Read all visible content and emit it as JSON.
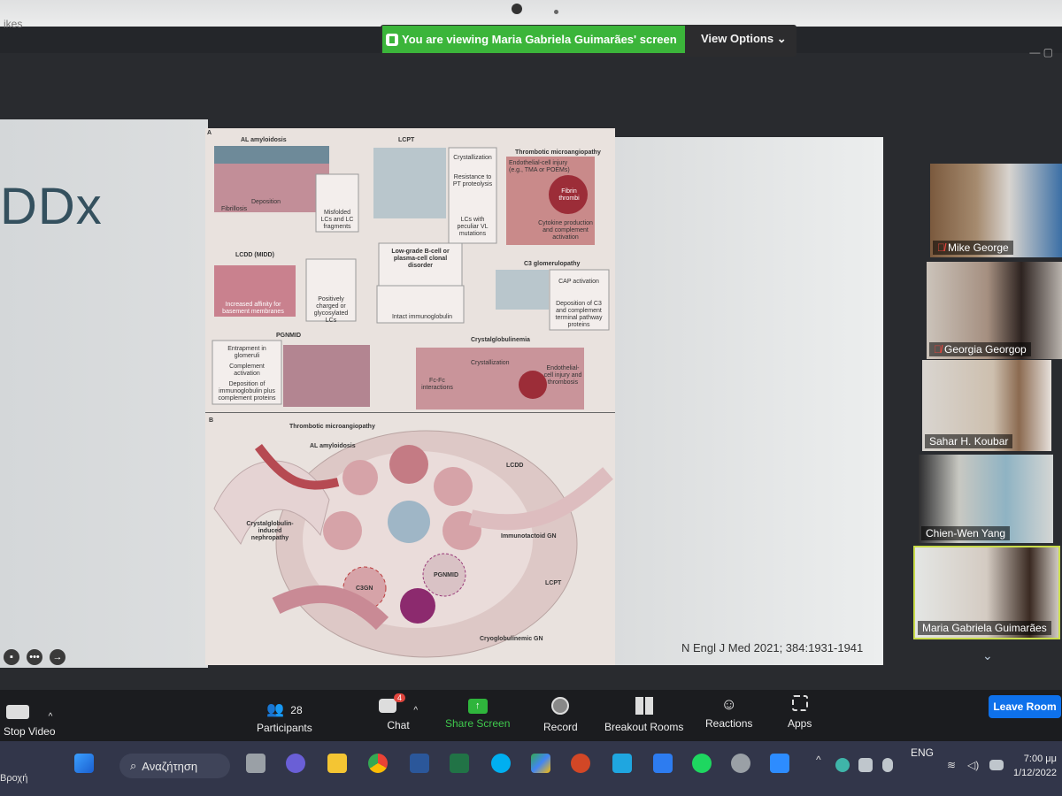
{
  "window": {
    "partial_title": "ikes",
    "controls": "— ▢"
  },
  "share_banner": {
    "viewing_text": "You are viewing Maria Gabriela Guimarães' screen",
    "view_options_label": "View Options"
  },
  "slide": {
    "title": "DDx",
    "citation": "N Engl J Med 2021; 384:1931-1941",
    "figure": {
      "panel_a_label": "A",
      "panel_b_label": "B",
      "a_labels": [
        "AL amyloidosis",
        "LCPT",
        "Thrombotic microangiopathy",
        "Crystallization",
        "Resistance to PT proteolysis",
        "Endothelial-cell injury (e.g., TMA or POEMs)",
        "Deposition",
        "Fibrillosis",
        "Misfolded LCs and LC fragments",
        "LCs with peculiar VL mutations",
        "Fibrin thrombi",
        "Cytokine production and complement activation",
        "Low-grade B-cell or plasma-cell clonal disorder",
        "LCDD (MIDD)",
        "C3 glomerulopathy",
        "Increased affinity for basement membranes",
        "Positively charged or glycosylated LCs",
        "Intact immunoglobulin",
        "CAP activation",
        "Deposition of C3 and complement terminal pathway proteins",
        "PGNMID",
        "Crystalglobulinemia",
        "Entrapment in glomeruli",
        "Complement activation",
        "Deposition of immunoglobulin plus complement proteins",
        "Crystallization",
        "Fc-Fc interactions",
        "Endothelial-cell injury and thrombosis"
      ],
      "b_labels": [
        "Thrombotic microangiopathy",
        "AL amyloidosis",
        "LCDD",
        "Crystalglobulin-induced nephropathy",
        "Immunotactoid GN",
        "PGNMID",
        "C3GN",
        "LCPT",
        "Cryoglobulinemic GN"
      ]
    }
  },
  "participants": [
    {
      "name": "Mike George",
      "muted": true
    },
    {
      "name": "Georgia Georgop",
      "muted": true
    },
    {
      "name": "Sahar H. Koubar",
      "muted": false
    },
    {
      "name": "Chien-Wen Yang",
      "muted": false
    },
    {
      "name": "Maria Gabriela Guimarães",
      "muted": false,
      "active_speaker": true
    }
  ],
  "toolbar": {
    "stop_video": "Stop Video",
    "participants_count": "28",
    "participants_label": "Participants",
    "chat_badge": "4",
    "chat_label": "Chat",
    "share_screen_label": "Share Screen",
    "record_label": "Record",
    "breakout_label": "Breakout Rooms",
    "reactions_label": "Reactions",
    "apps_label": "Apps",
    "leave_label": "Leave Room"
  },
  "taskbar": {
    "weather": "Βροχή",
    "search_placeholder": "Αναζήτηση",
    "lang": "ENG",
    "time": "7:00 μμ",
    "date": "1/12/2022"
  },
  "colors": {
    "share_green": "#3bb53a",
    "leave_blue": "#0e71eb",
    "active_speaker_border": "#c9dc4a",
    "mute_red": "#e0453d"
  }
}
